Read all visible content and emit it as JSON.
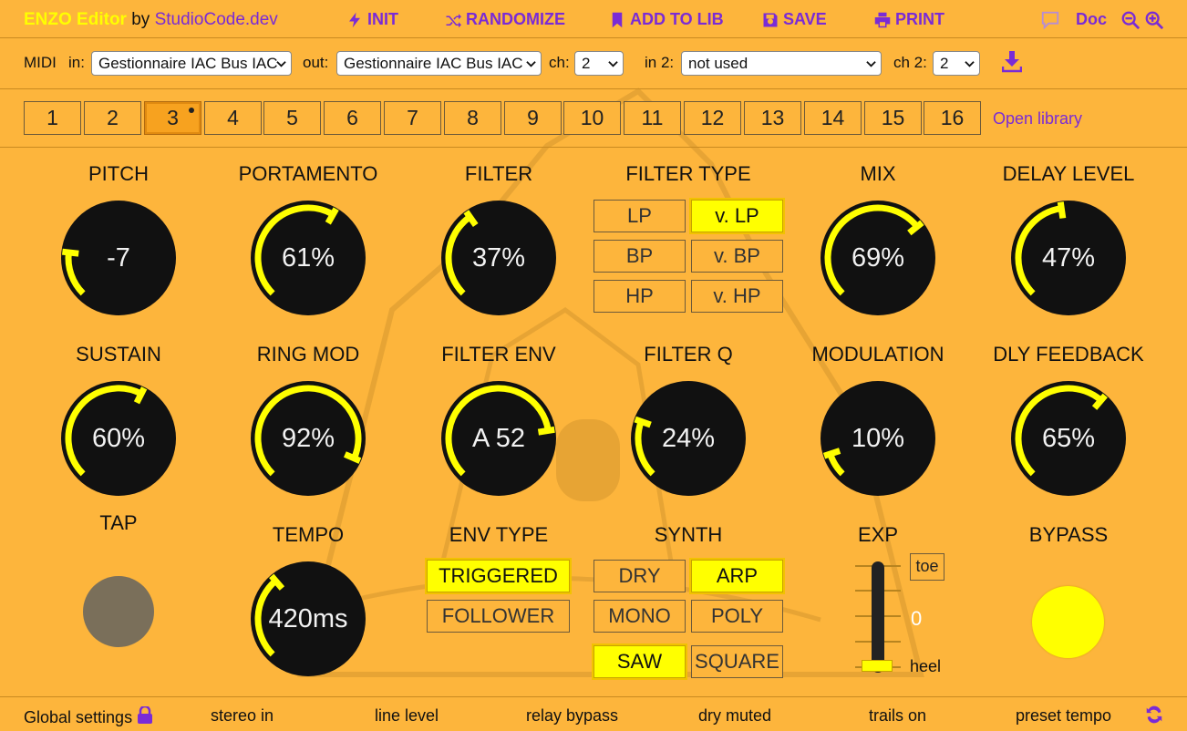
{
  "app": {
    "name": "ENZO Editor",
    "by": "by",
    "studio": "StudioCode.dev"
  },
  "toolbar": {
    "init": "INIT",
    "randomize": "RANDOMIZE",
    "add_to_lib": "ADD TO LIB",
    "save": "SAVE",
    "print": "PRINT",
    "doc": "Doc"
  },
  "midi": {
    "label": "MIDI",
    "in_label": "in:",
    "in_value": "Gestionnaire IAC Bus IAC",
    "out_label": "out:",
    "out_value": "Gestionnaire IAC Bus IAC",
    "ch_label": "ch:",
    "ch_value": "2",
    "in2_label": "in 2:",
    "in2_value": "not used",
    "ch2_label": "ch 2:",
    "ch2_value": "2"
  },
  "presets": {
    "numbers": [
      "1",
      "2",
      "3",
      "4",
      "5",
      "6",
      "7",
      "8",
      "9",
      "10",
      "11",
      "12",
      "13",
      "14",
      "15",
      "16"
    ],
    "active": 3,
    "open_library": "Open library"
  },
  "knobs": {
    "pitch": {
      "label": "PITCH",
      "value": "-7",
      "level": 0.19
    },
    "portamento": {
      "label": "PORTAMENTO",
      "value": "61%",
      "level": 0.61
    },
    "filter": {
      "label": "FILTER",
      "value": "37%",
      "level": 0.37
    },
    "mix": {
      "label": "MIX",
      "value": "69%",
      "level": 0.69
    },
    "delay_level": {
      "label": "DELAY LEVEL",
      "value": "47%",
      "level": 0.47
    },
    "sustain": {
      "label": "SUSTAIN",
      "value": "60%",
      "level": 0.6
    },
    "ring_mod": {
      "label": "RING MOD",
      "value": "92%",
      "level": 0.92
    },
    "filter_env": {
      "label": "FILTER ENV",
      "value": "A 52",
      "level": 0.8
    },
    "filter_q": {
      "label": "FILTER Q",
      "value": "24%",
      "level": 0.24
    },
    "modulation": {
      "label": "MODULATION",
      "value": "10%",
      "level": 0.1
    },
    "dly_feedback": {
      "label": "DLY FEEDBACK",
      "value": "65%",
      "level": 0.65
    },
    "tempo": {
      "label": "TEMPO",
      "value": "420ms",
      "level": 0.35
    }
  },
  "filter_type": {
    "label": "FILTER TYPE",
    "lp": "LP",
    "vlp": "v. LP",
    "bp": "BP",
    "vbp": "v. BP",
    "hp": "HP",
    "vhp": "v. HP",
    "selected": "v. LP"
  },
  "env_type": {
    "label": "ENV TYPE",
    "triggered": "TRIGGERED",
    "follower": "FOLLOWER",
    "selected": "TRIGGERED"
  },
  "synth": {
    "label": "SYNTH",
    "dry": "DRY",
    "arp": "ARP",
    "mono": "MONO",
    "poly": "POLY",
    "saw": "SAW",
    "square": "SQUARE",
    "selected": [
      "ARP",
      "SAW"
    ]
  },
  "tap": {
    "label": "TAP"
  },
  "exp": {
    "label": "EXP",
    "toe": "toe",
    "value": "0",
    "heel": "heel",
    "level": 0.0
  },
  "bypass": {
    "label": "BYPASS"
  },
  "footer": {
    "global_settings": "Global settings",
    "stereo_in": "stereo in",
    "line_level": "line level",
    "relay_bypass": "relay bypass",
    "dry_muted": "dry muted",
    "trails_on": "trails on",
    "preset_tempo": "preset tempo"
  },
  "colors": {
    "background": "#fdb53c",
    "accent": "#ffff00",
    "link": "#7a2bd6",
    "knob": "#111111"
  }
}
